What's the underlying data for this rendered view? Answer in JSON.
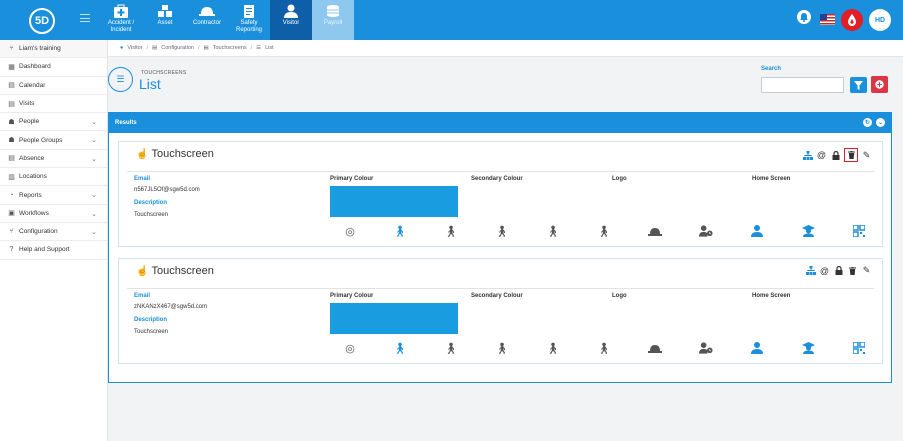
{
  "brand": {
    "logo_text": "5D"
  },
  "topnav": {
    "tabs": [
      {
        "label": "Accident / Incident",
        "icon": "first-aid-icon"
      },
      {
        "label": "Asset",
        "icon": "boxes-icon"
      },
      {
        "label": "Contractor",
        "icon": "hardhat-icon"
      },
      {
        "label": "Safety Reporting",
        "icon": "clipboard-icon"
      },
      {
        "label": "Visitor",
        "icon": "user-icon"
      },
      {
        "label": "Payroll",
        "icon": "coins-icon"
      }
    ],
    "avatar_initials": "HD"
  },
  "sidebar": {
    "items": [
      {
        "label": "Liam's training",
        "has_chevron": false
      },
      {
        "label": "Dashboard",
        "has_chevron": false
      },
      {
        "label": "Calendar",
        "has_chevron": false
      },
      {
        "label": "Visits",
        "has_chevron": false
      },
      {
        "label": "People",
        "has_chevron": true
      },
      {
        "label": "People Groups",
        "has_chevron": true
      },
      {
        "label": "Absence",
        "has_chevron": true
      },
      {
        "label": "Locations",
        "has_chevron": false
      },
      {
        "label": "Reports",
        "has_chevron": true
      },
      {
        "label": "Workflows",
        "has_chevron": true
      },
      {
        "label": "Configuration",
        "has_chevron": true
      },
      {
        "label": "Help and Support",
        "has_chevron": false
      }
    ]
  },
  "breadcrumb": [
    "Visitor",
    "Configuration",
    "Touchscreens",
    "List"
  ],
  "header": {
    "subtitle": "TOUCHSCREENS",
    "title": "List"
  },
  "search": {
    "label": "Search",
    "placeholder": ""
  },
  "results": {
    "title": "Results",
    "columns": {
      "primary": "Primary Colour",
      "secondary": "Secondary Colour",
      "logo": "Logo",
      "home": "Home Screen"
    },
    "labels": {
      "email": "Email",
      "description": "Description"
    },
    "cards": [
      {
        "title": "Touchscreen",
        "email": "n567JL5Of@sgw5d.com",
        "description": "Touchscreen",
        "primary_colour": "#1a9ce0"
      },
      {
        "title": "Touchscreen",
        "email": "zNKANzX467@sgw5d.com",
        "description": "Touchscreen",
        "primary_colour": "#1a9ce0"
      }
    ]
  },
  "colors": {
    "accent": "#1a8fdc",
    "danger": "#e41e26"
  }
}
